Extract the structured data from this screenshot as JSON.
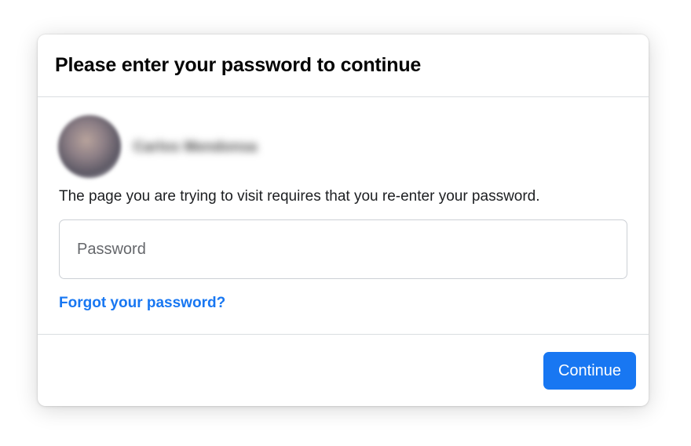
{
  "dialog": {
    "title": "Please enter your password to continue",
    "profile": {
      "name": "Carlos Mendonsa"
    },
    "message": "The page you are trying to visit requires that you re-enter your password.",
    "password_input": {
      "value": "",
      "placeholder": "Password"
    },
    "forgot_link": "Forgot your password?",
    "continue_label": "Continue"
  },
  "colors": {
    "accent": "#1877f2",
    "divider": "#dadde1",
    "title_text": "#050505"
  }
}
